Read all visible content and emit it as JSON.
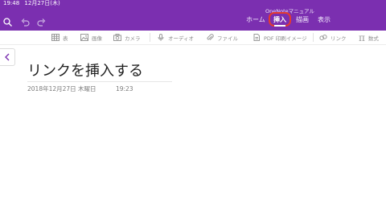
{
  "status": {
    "time": "19:48",
    "date": "12月27日(木)"
  },
  "app": {
    "name": "OneNoteマニュアル"
  },
  "tabs": [
    {
      "label": "ホーム"
    },
    {
      "label": "挿入"
    },
    {
      "label": "描画"
    },
    {
      "label": "表示"
    }
  ],
  "toolbar": {
    "table": "表",
    "image": "画像",
    "camera": "カメラ",
    "audio": "オーディオ",
    "file": "ファイル",
    "pdf": "PDF 印刷イメージ",
    "link": "リンク",
    "math": "数式"
  },
  "page": {
    "title": "リンクを挿入する",
    "date": "2018年12月27日 木曜日",
    "time": "19:23"
  },
  "colors": {
    "accent": "#7b2fb0",
    "highlight": "#e53a2f"
  }
}
